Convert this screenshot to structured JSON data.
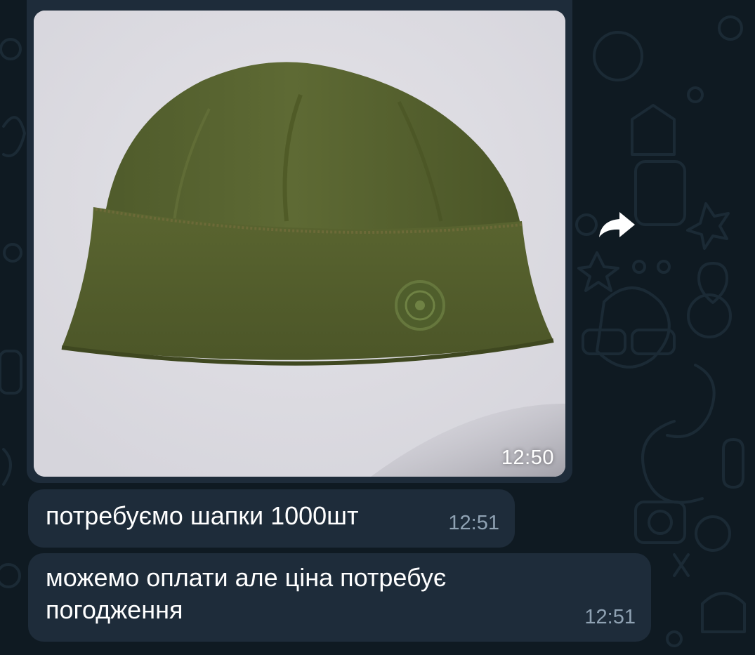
{
  "colors": {
    "background": "#0f1a22",
    "bubble": "#1e2c3a",
    "time_text": "#8fa2b3",
    "text": "#ffffff"
  },
  "photo_message": {
    "icon": "hat-photo",
    "time": "12:50"
  },
  "forward_button": {
    "icon": "forward-arrow-icon"
  },
  "messages": [
    {
      "text": "потребуємо шапки 1000шт",
      "time": "12:51"
    },
    {
      "text": "можемо оплати але ціна потребує\nпогодження",
      "time": "12:51"
    }
  ]
}
